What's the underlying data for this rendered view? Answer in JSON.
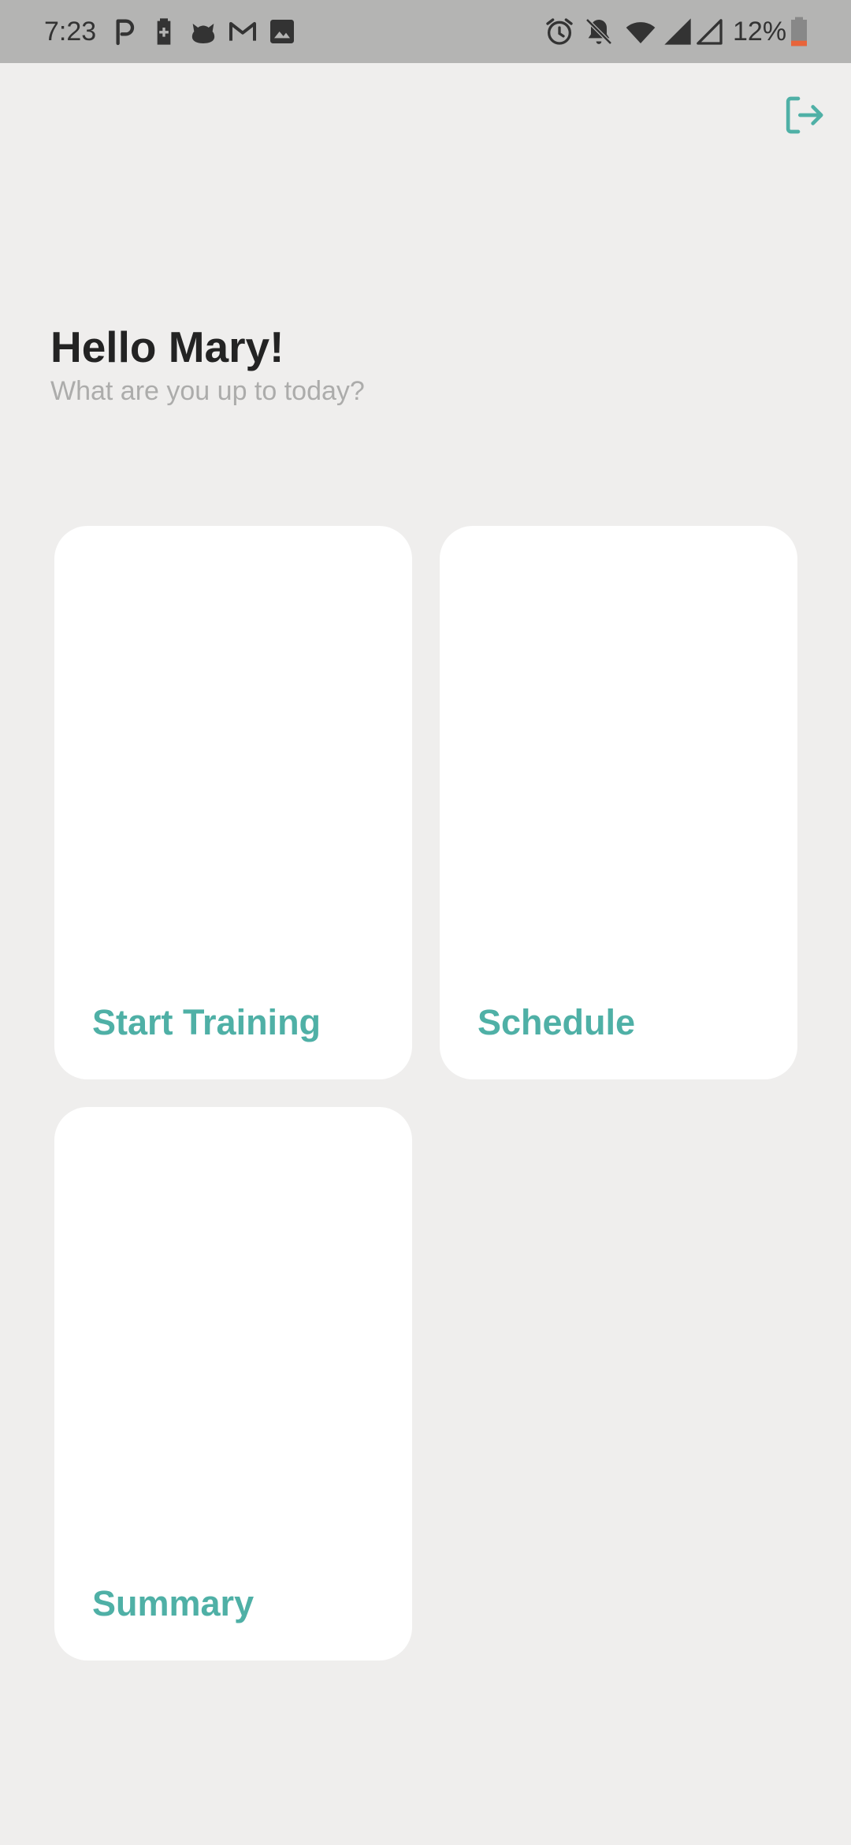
{
  "status_bar": {
    "time": "7:23",
    "battery_percent": "12%",
    "left_icons": [
      "parking-icon",
      "battery-saver-icon",
      "cat-icon",
      "gmail-icon",
      "image-icon"
    ],
    "right_icons": [
      "alarm-icon",
      "notifications-off-icon",
      "wifi-icon",
      "signal-icon",
      "signal-empty-icon",
      "battery-low-icon"
    ]
  },
  "header": {
    "logout_icon": "logout-icon"
  },
  "main": {
    "greeting": "Hello Mary!",
    "subtitle": "What are you up to today?",
    "cards": [
      {
        "label": "Start Training"
      },
      {
        "label": "Schedule"
      },
      {
        "label": "Summary"
      }
    ]
  },
  "colors": {
    "background": "#efeeed",
    "status_bar": "#b4b4b3",
    "accent": "#4fb0a6",
    "card": "#ffffff",
    "title": "#232323",
    "subtitle": "#acacab",
    "battery_low": "#e8643a"
  }
}
